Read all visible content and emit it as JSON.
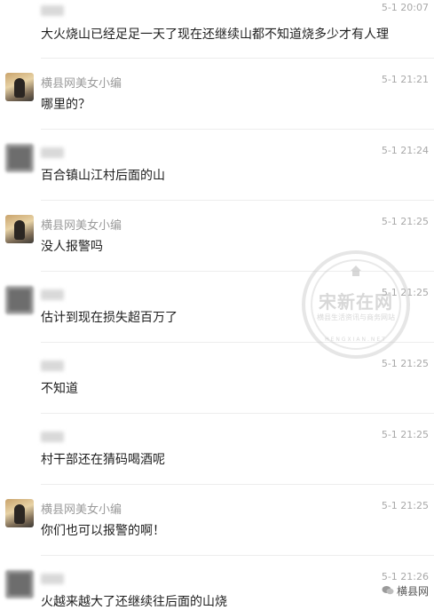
{
  "messages": [
    {
      "avatar": "none",
      "name": "",
      "time": "5-1 20:07",
      "text": "大火烧山已经足足一天了现在还继续山都不知道烧多少才有人理"
    },
    {
      "avatar": "photo",
      "name": "横县网美女小编",
      "time": "5-1 21:21",
      "text": "哪里的？"
    },
    {
      "avatar": "blur",
      "name": "",
      "time": "5-1 21:24",
      "text": "百合镇山江村后面的山"
    },
    {
      "avatar": "photo",
      "name": "横县网美女小编",
      "time": "5-1 21:25",
      "text": "没人报警吗"
    },
    {
      "avatar": "blur",
      "name": "",
      "time": "5-1 21:25",
      "text": "估计到现在损失超百万了"
    },
    {
      "avatar": "none",
      "name": "",
      "time": "5-1 21:25",
      "text": "不知道"
    },
    {
      "avatar": "none",
      "name": "",
      "time": "5-1 21:25",
      "text": "村干部还在猜码喝酒呢"
    },
    {
      "avatar": "photo",
      "name": "横县网美女小编",
      "time": "5-1 21:25",
      "text": "你们也可以报警的啊！"
    },
    {
      "avatar": "blur",
      "name": "",
      "time": "5-1 21:26",
      "text": "火越来越大了还继续往后面的山烧"
    }
  ],
  "watermark": {
    "title": "宋新在网",
    "subtitle": "横县生活资讯与商务网站",
    "arc": "HENGXIAN.NET"
  },
  "badge": {
    "label": "横县网",
    "icon": "wechat-icon"
  },
  "colors": {
    "time": "#a8a8a8",
    "name": "#9b9b9b",
    "text": "#1f1f1f",
    "divider": "#ededed"
  }
}
